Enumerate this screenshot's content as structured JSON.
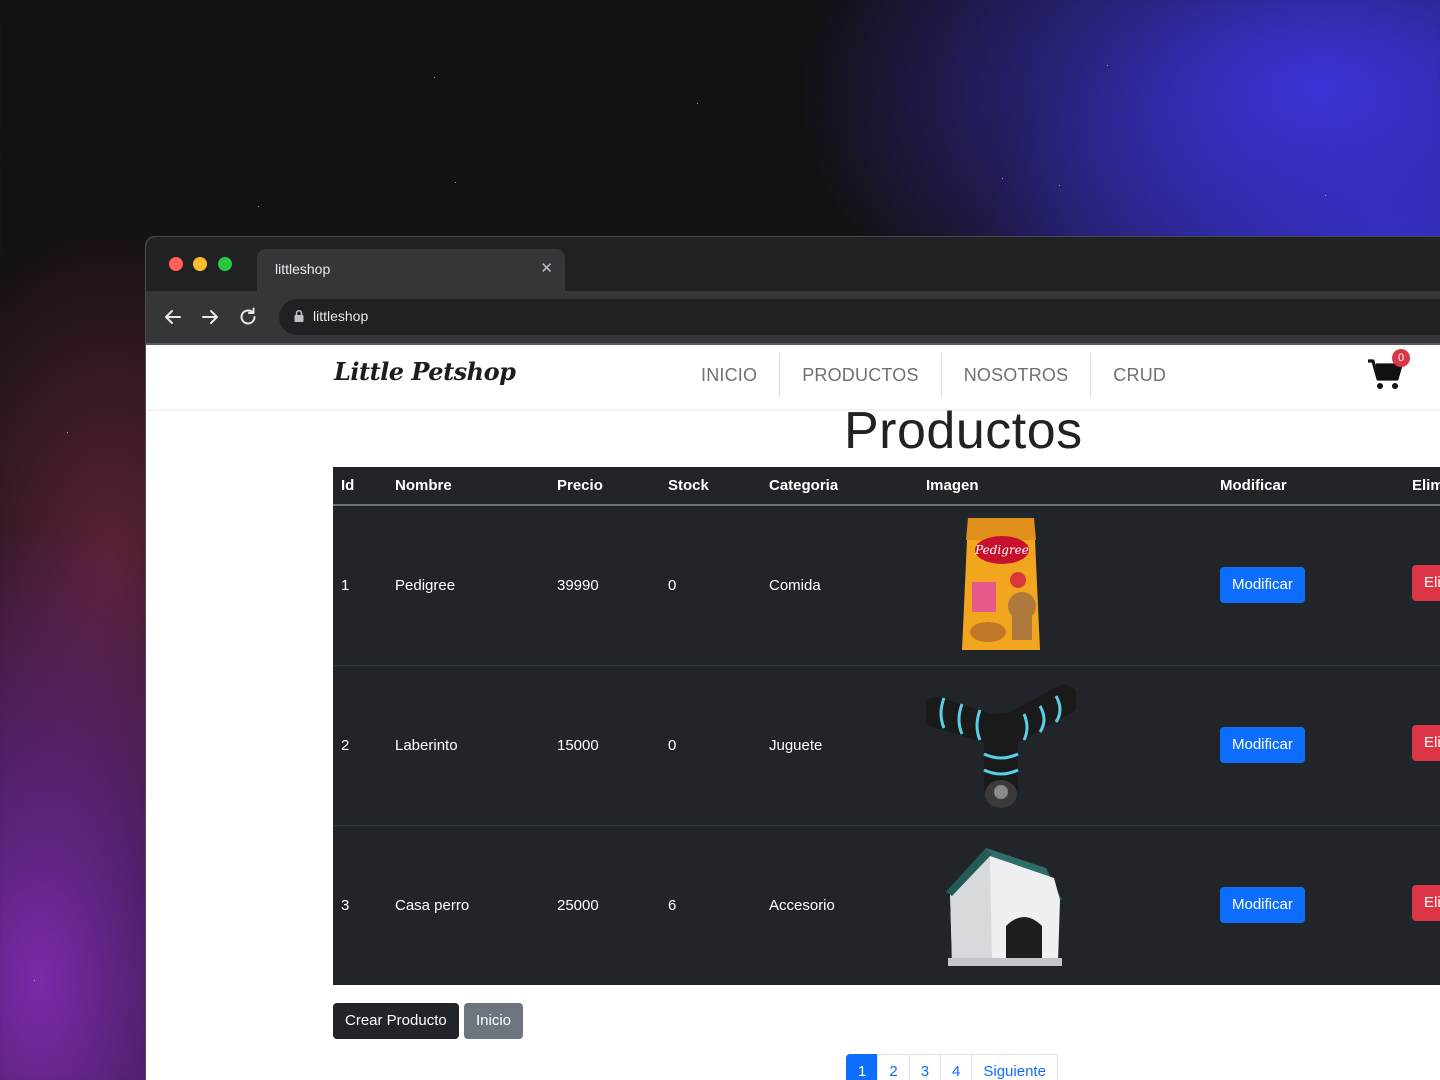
{
  "browser": {
    "tab_title": "littleshop",
    "url": "littleshop"
  },
  "site": {
    "logo": "Little Petshop",
    "menu": [
      "INICIO",
      "PRODUCTOS",
      "NOSOTROS",
      "CRUD"
    ],
    "cart_count": "0"
  },
  "page": {
    "title": "Productos"
  },
  "table": {
    "headers": [
      "Id",
      "Nombre",
      "Precio",
      "Stock",
      "Categoria",
      "Imagen",
      "Modificar",
      "Elim"
    ],
    "rows": [
      {
        "id": "1",
        "nombre": "Pedigree",
        "precio": "39990",
        "stock": "0",
        "categoria": "Comida",
        "imagen": "dog-food-bag-image",
        "modificar": "Modificar",
        "eliminar": "Eli"
      },
      {
        "id": "2",
        "nombre": "Laberinto",
        "precio": "15000",
        "stock": "0",
        "categoria": "Juguete",
        "imagen": "cat-tunnel-image",
        "modificar": "Modificar",
        "eliminar": "Eli"
      },
      {
        "id": "3",
        "nombre": "Casa perro",
        "precio": "25000",
        "stock": "6",
        "categoria": "Accesorio",
        "imagen": "dog-house-image",
        "modificar": "Modificar",
        "eliminar": "Eli"
      }
    ],
    "image_text": "Pedigree"
  },
  "actions": {
    "create": "Crear Producto",
    "home": "Inicio"
  },
  "pagination": {
    "pages": [
      "1",
      "2",
      "3",
      "4"
    ],
    "next": "Siguiente",
    "active": "1"
  },
  "colors": {
    "primary": "#0d6efd",
    "danger": "#dc3545",
    "dark": "#212529",
    "secondary": "#6c757d"
  }
}
